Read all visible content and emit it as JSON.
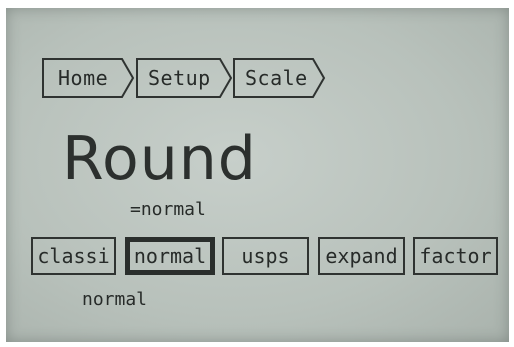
{
  "breadcrumb": {
    "items": [
      {
        "label": "Home"
      },
      {
        "label": "Setup"
      },
      {
        "label": "Scale"
      }
    ]
  },
  "title": "Round",
  "current_value": "=normal",
  "options": [
    {
      "label": "classi",
      "selected": false
    },
    {
      "label": "normal",
      "selected": true
    },
    {
      "label": "usps",
      "selected": false
    },
    {
      "label": "expand",
      "selected": false
    },
    {
      "label": "factor",
      "selected": false
    }
  ],
  "status_text": "normal",
  "colors": {
    "lcd_background": "#b9c2bc",
    "ink": "#272b29"
  }
}
